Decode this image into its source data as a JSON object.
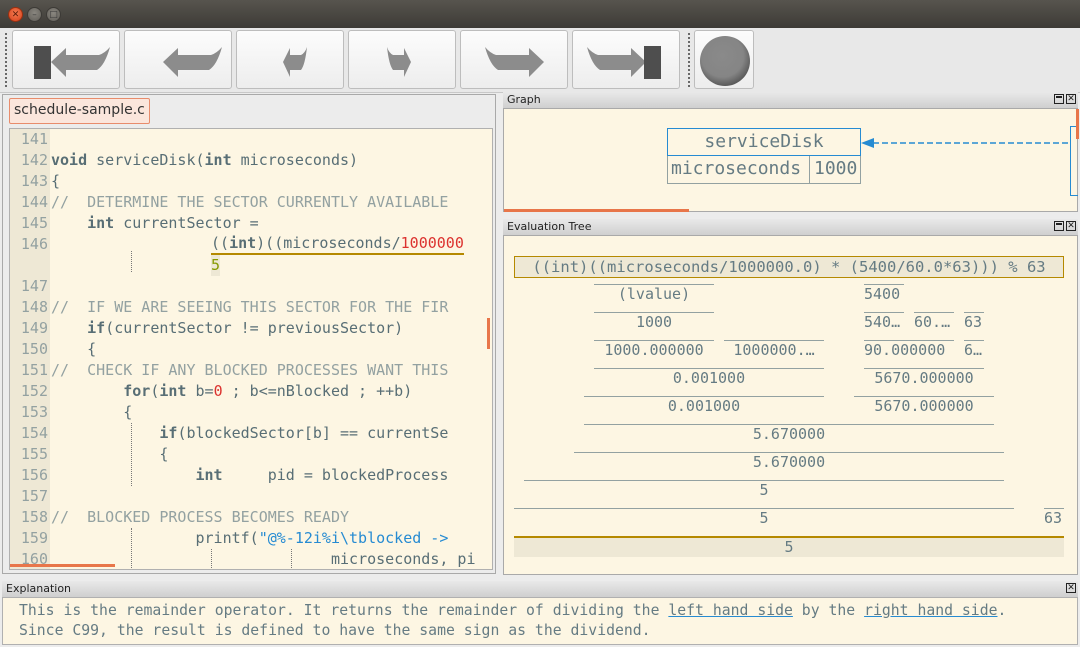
{
  "window": {
    "controls": [
      "close",
      "minimize",
      "maximize"
    ]
  },
  "toolbar": {
    "buttons": [
      {
        "name": "jump-to-start",
        "icon": "rewind-to-start-icon"
      },
      {
        "name": "step-back-out",
        "icon": "step-back-icon"
      },
      {
        "name": "step-back-in",
        "icon": "small-step-back-icon"
      },
      {
        "name": "step-forward-in",
        "icon": "small-step-forward-icon"
      },
      {
        "name": "step-forward-out",
        "icon": "step-forward-icon"
      },
      {
        "name": "jump-to-end",
        "icon": "forward-to-end-icon"
      }
    ],
    "record_button": {
      "icon": "record-circle-icon"
    }
  },
  "editor": {
    "tab_label": "schedule-sample.c",
    "lines": [
      {
        "n": "141"
      },
      {
        "n": "142"
      },
      {
        "n": "143"
      },
      {
        "n": "144"
      },
      {
        "n": "145"
      },
      {
        "n": "146"
      },
      {
        "n": ""
      },
      {
        "n": "147"
      },
      {
        "n": "148"
      },
      {
        "n": "149"
      },
      {
        "n": "150"
      },
      {
        "n": "151"
      },
      {
        "n": "152"
      },
      {
        "n": "153"
      },
      {
        "n": "154"
      },
      {
        "n": "155"
      },
      {
        "n": "156"
      },
      {
        "n": "157"
      },
      {
        "n": "158"
      },
      {
        "n": "159"
      },
      {
        "n": "160"
      }
    ],
    "code": {
      "l142_kw": "void",
      "l142_rest": " serviceDisk(",
      "l142_kw2": "int",
      "l142_rest2": " microseconds)",
      "l143": "{",
      "l144": "//  DETERMINE THE SECTOR CURRENTLY AVAILABLE",
      "l145_kw": "int",
      "l145_rest": " currentSector =",
      "l146_a": "((",
      "l146_kw": "int",
      "l146_b": ")((microseconds/",
      "l146_num": "1000000",
      "l146_value": "5",
      "l148": "//  IF WE ARE SEEING THIS SECTOR FOR THE FIR",
      "l149_kw": "if",
      "l149_rest": "(currentSector != previousSector)",
      "l150": "{",
      "l151": "//  CHECK IF ANY BLOCKED PROCESSES WANT THIS",
      "l152_kw": "for",
      "l152_a": "(",
      "l152_kw2": "int",
      "l152_b": " b=",
      "l152_num": "0",
      "l152_c": " ; b<=nBlocked ; ++b)",
      "l153": "{",
      "l154_kw": "if",
      "l154_rest": "(blockedSector[b] == currentSe",
      "l155": "{",
      "l156_kw": "int",
      "l156_rest": "     pid = blockedProcess",
      "l158": "//  BLOCKED PROCESS BECOMES READY",
      "l159_a": "printf(",
      "l159_str": "\"@%-12i%i\\tblocked ->",
      "l160": "microseconds, pi"
    }
  },
  "graph_panel": {
    "title": "Graph",
    "frame_name": "serviceDisk",
    "variables": [
      {
        "name": "microseconds",
        "value": "1000"
      }
    ]
  },
  "evaluation_tree": {
    "title": "Evaluation Tree",
    "expression": "((int)((microseconds/1000000.0) * (5400/60.0*63))) % 63",
    "nodes": {
      "lvalue": "(lvalue)",
      "microseconds_val": "1000",
      "cast_double": "1000.000000",
      "divisor": "1000000.…",
      "div_result": "0.001000",
      "paren_result": "0.001000",
      "n5400": "5400",
      "n5400_conv": "540…",
      "n60": "60.…",
      "n63_a": "63",
      "div_5400_60": "90.000000",
      "n63_conv": "6…",
      "mult_inner": "5670.000000",
      "paren_inner": "5670.000000",
      "product": "5.670000",
      "paren_product": "5.670000",
      "int_cast": "5",
      "paren_cast": "5",
      "n63_b": "63",
      "final": "5"
    }
  },
  "explanation": {
    "title": "Explanation",
    "text_1": "This is the remainder operator. It returns the remainder of dividing the ",
    "link_1": "left hand side",
    "text_2": " by the ",
    "link_2": "right hand side",
    "text_3": ". Since C99, the result is defined to have the same sign as the dividend."
  }
}
